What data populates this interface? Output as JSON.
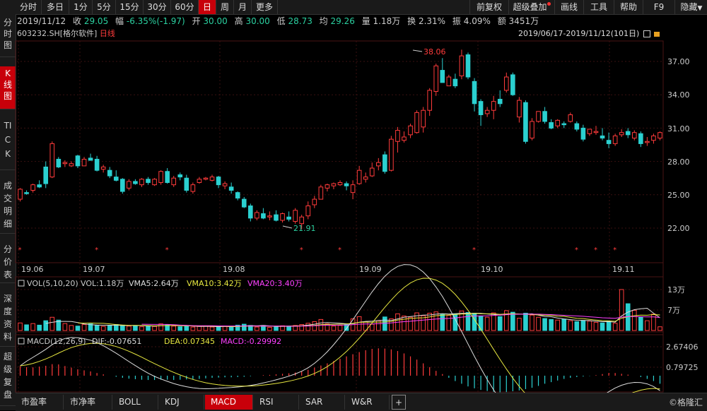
{
  "topbar": {
    "tabs": [
      "分时",
      "多日",
      "1分",
      "5分",
      "15分",
      "30分",
      "60分",
      "日",
      "周",
      "月",
      "更多"
    ],
    "active_tab": "日",
    "right": [
      "前复权",
      "超级叠加",
      "画线",
      "工具",
      "帮助",
      "F9",
      "隐藏"
    ]
  },
  "quote": {
    "date": "2019/11/12",
    "close_label": "收",
    "close": "29.05",
    "change_label": "幅",
    "change": "-6.35%(-1.97)",
    "open_label": "开",
    "open": "30.00",
    "high_label": "高",
    "high": "30.00",
    "low_label": "低",
    "low": "28.73",
    "avg_label": "均",
    "avg": "29.26",
    "volume_label": "量",
    "volume": "1.18万",
    "turnover_label": "换",
    "turnover": "2.31%",
    "amplitude_label": "振",
    "amplitude": "4.09%",
    "amount_label": "额",
    "amount": "3451万"
  },
  "leftnav": [
    "分时图",
    "K线图",
    "TICK",
    "成交明细",
    "分价表",
    "深度资料",
    "超级复盘"
  ],
  "leftnav_active": "K线图",
  "chart_header": {
    "symbol": "603232.SH",
    "name": "[格尔软件]",
    "period": "日线",
    "date_range": "2019/06/17-2019/11/12(101日)"
  },
  "price_axis": [
    "37.00",
    "34.00",
    "31.00",
    "28.00",
    "25.00",
    "22.00"
  ],
  "date_axis": [
    "19.06",
    "19.07",
    "19.08",
    "19.09",
    "19.10",
    "19.11"
  ],
  "annotations": {
    "high": "38.06",
    "low": "21.91"
  },
  "vol_header": {
    "title": "VOL(5,10,20)",
    "vol": "VOL:1.18万",
    "vma5": "VMA5:2.64万",
    "vma10": "VMA10:3.42万",
    "vma20": "VMA20:3.40万"
  },
  "vol_axis": [
    "13万",
    "7万"
  ],
  "macd_header": {
    "title": "MACD(12,26,9)",
    "dif": "DIF:-0.07651",
    "dea": "DEA:0.07345",
    "macd": "MACD:-0.29992"
  },
  "macd_axis": [
    "2.67406",
    "0.79725"
  ],
  "bottombar": [
    "市盈率",
    "市净率",
    "BOLL",
    "KDJ",
    "MACD",
    "RSI",
    "SAR",
    "W&R",
    "+"
  ],
  "bottom_active": "MACD",
  "watermark": "©格隆汇",
  "colors": {
    "up": "#ff3b3b",
    "down": "#2bd0d0",
    "accent": "#c8000a",
    "grid": "#3a1010"
  },
  "chart_data": {
    "type": "candlestick",
    "ylim": [
      21,
      38.5
    ],
    "candles": [
      [
        24.6,
        25.6,
        24.4,
        25.5
      ],
      [
        25.2,
        25.4,
        25.0,
        25.1
      ],
      [
        25.4,
        26.0,
        25.2,
        25.9
      ],
      [
        25.9,
        26.3,
        25.6,
        25.7
      ],
      [
        27.5,
        28.0,
        25.6,
        26.0
      ],
      [
        26.6,
        29.8,
        26.5,
        29.6
      ],
      [
        28.2,
        28.4,
        27.4,
        27.5
      ],
      [
        27.8,
        28.1,
        27.5,
        27.9
      ],
      [
        27.6,
        28.0,
        27.5,
        27.8
      ],
      [
        28.5,
        28.6,
        27.4,
        27.6
      ],
      [
        27.6,
        28.4,
        27.6,
        28.2
      ],
      [
        28.3,
        28.7,
        28.1,
        28.1
      ],
      [
        28.2,
        28.5,
        27.1,
        27.2
      ],
      [
        27.3,
        27.7,
        27.0,
        27.5
      ],
      [
        27.2,
        27.5,
        26.5,
        26.7
      ],
      [
        26.6,
        27.2,
        26.2,
        26.3
      ],
      [
        26.4,
        26.5,
        25.1,
        25.3
      ],
      [
        25.6,
        26.4,
        25.4,
        26.2
      ],
      [
        26.2,
        26.4,
        25.9,
        26.0
      ],
      [
        25.9,
        26.5,
        25.7,
        26.4
      ],
      [
        26.4,
        26.6,
        25.9,
        26.1
      ],
      [
        25.9,
        26.5,
        25.8,
        26.4
      ],
      [
        26.1,
        27.2,
        25.9,
        27.1
      ],
      [
        27.1,
        27.4,
        26.0,
        26.1
      ],
      [
        25.9,
        26.7,
        25.7,
        26.5
      ],
      [
        26.8,
        27.0,
        26.3,
        26.6
      ],
      [
        26.5,
        26.8,
        25.2,
        25.4
      ],
      [
        25.3,
        26.1,
        25.1,
        25.9
      ],
      [
        26.1,
        26.6,
        26.0,
        26.4
      ],
      [
        26.4,
        26.6,
        26.3,
        26.5
      ],
      [
        26.3,
        26.8,
        26.2,
        26.6
      ],
      [
        26.6,
        26.7,
        25.6,
        25.9
      ],
      [
        25.8,
        26.2,
        25.5,
        26.0
      ],
      [
        25.7,
        26.1,
        25.1,
        25.4
      ],
      [
        25.2,
        25.3,
        24.5,
        24.7
      ],
      [
        24.6,
        24.8,
        23.8,
        23.9
      ],
      [
        24.0,
        24.2,
        22.6,
        22.9
      ],
      [
        22.9,
        23.6,
        22.7,
        23.4
      ],
      [
        23.3,
        23.8,
        22.8,
        22.9
      ],
      [
        23.0,
        23.5,
        22.7,
        23.1
      ],
      [
        23.2,
        23.6,
        22.6,
        22.7
      ],
      [
        22.7,
        23.4,
        22.5,
        23.3
      ],
      [
        23.0,
        23.5,
        22.6,
        22.8
      ],
      [
        22.6,
        23.8,
        22.4,
        23.6
      ],
      [
        22.4,
        23.2,
        21.9,
        23.0
      ],
      [
        23.1,
        24.4,
        22.8,
        24.0
      ],
      [
        24.1,
        24.9,
        23.8,
        24.6
      ],
      [
        24.6,
        25.9,
        24.6,
        25.7
      ],
      [
        25.6,
        26.0,
        25.3,
        25.9
      ],
      [
        25.8,
        26.1,
        25.5,
        26.0
      ],
      [
        25.9,
        26.3,
        25.8,
        26.1
      ],
      [
        26.0,
        26.2,
        25.4,
        25.8
      ],
      [
        25.2,
        26.3,
        24.6,
        25.9
      ],
      [
        26.0,
        27.6,
        25.9,
        27.2
      ],
      [
        26.4,
        27.0,
        26.1,
        26.6
      ],
      [
        26.7,
        27.9,
        26.6,
        27.4
      ],
      [
        27.6,
        28.3,
        27.2,
        27.9
      ],
      [
        28.6,
        28.9,
        26.9,
        27.1
      ],
      [
        27.2,
        30.3,
        27.1,
        30.0
      ],
      [
        29.8,
        31.1,
        28.8,
        30.8
      ],
      [
        29.9,
        30.7,
        29.7,
        30.2
      ],
      [
        30.4,
        31.4,
        30.1,
        31.2
      ],
      [
        30.6,
        32.6,
        30.5,
        32.4
      ],
      [
        31.1,
        32.9,
        30.6,
        32.6
      ],
      [
        32.6,
        34.6,
        32.1,
        34.4
      ],
      [
        34.3,
        36.8,
        33.9,
        36.6
      ],
      [
        36.2,
        37.3,
        35.1,
        35.1
      ],
      [
        34.8,
        35.8,
        34.8,
        35.6
      ],
      [
        35.4,
        35.9,
        34.6,
        34.8
      ],
      [
        35.7,
        38.06,
        35.4,
        37.5
      ],
      [
        37.6,
        37.8,
        35.4,
        35.6
      ],
      [
        35.2,
        35.5,
        32.5,
        33.2
      ],
      [
        33.4,
        33.6,
        31.2,
        32.2
      ],
      [
        32.3,
        32.9,
        32.0,
        32.6
      ],
      [
        32.6,
        33.9,
        31.8,
        33.4
      ],
      [
        33.6,
        34.4,
        32.9,
        33.2
      ],
      [
        34.4,
        36.0,
        34.2,
        35.6
      ],
      [
        35.8,
        36.0,
        33.9,
        34.0
      ],
      [
        32.0,
        33.8,
        31.5,
        33.5
      ],
      [
        33.3,
        33.5,
        29.6,
        29.8
      ],
      [
        30.1,
        31.9,
        29.9,
        31.6
      ],
      [
        31.6,
        32.5,
        31.5,
        32.5
      ],
      [
        32.5,
        32.9,
        31.4,
        31.6
      ],
      [
        31.5,
        31.8,
        30.9,
        31.0
      ],
      [
        31.2,
        31.8,
        31.0,
        31.7
      ],
      [
        31.4,
        31.6,
        31.0,
        31.3
      ],
      [
        31.6,
        32.4,
        31.5,
        32.2
      ],
      [
        31.4,
        31.6,
        30.7,
        30.9
      ],
      [
        31.0,
        31.3,
        29.8,
        30.0
      ],
      [
        30.5,
        30.9,
        30.3,
        30.9
      ],
      [
        30.6,
        31.2,
        30.4,
        30.7
      ],
      [
        30.3,
        31.0,
        29.9,
        30.1
      ],
      [
        29.9,
        30.6,
        29.2,
        29.6
      ],
      [
        29.6,
        30.5,
        29.4,
        30.3
      ],
      [
        30.4,
        30.9,
        30.2,
        30.6
      ],
      [
        30.7,
        31.0,
        30.1,
        30.4
      ],
      [
        30.1,
        30.8,
        29.9,
        30.6
      ],
      [
        30.5,
        30.7,
        29.3,
        29.6
      ],
      [
        29.7,
        30.2,
        29.4,
        29.8
      ],
      [
        29.9,
        30.5,
        29.6,
        30.3
      ],
      [
        30.1,
        30.7,
        29.9,
        30.6
      ]
    ],
    "volumes_wan": [
      2.4,
      1.8,
      2.2,
      1.7,
      3.1,
      4.2,
      3.3,
      2.2,
      1.6,
      1.4,
      1.9,
      2.1,
      1.6,
      1.3,
      1.5,
      1.9,
      1.7,
      1.4,
      1.5,
      1.2,
      1.5,
      1.3,
      2.1,
      1.8,
      1.4,
      1.2,
      1.5,
      1.1,
      1.3,
      1.4,
      1.1,
      1.2,
      1.4,
      1.0,
      1.7,
      2.0,
      1.6,
      1.1,
      1.6,
      1.0,
      1.2,
      1.5,
      1.4,
      1.6,
      1.9,
      2.3,
      2.8,
      3.5,
      2.1,
      1.4,
      1.6,
      2.0,
      3.7,
      4.4,
      2.8,
      2.0,
      3.1,
      4.3,
      3.7,
      5.3,
      4.6,
      4.2,
      5.6,
      4.7,
      5.5,
      5.9,
      5.1,
      4.8,
      5.3,
      6.2,
      5.7,
      5.5,
      4.6,
      4.2,
      5.6,
      4.4,
      6.3,
      5.8,
      3.9,
      5.5,
      4.9,
      4.2,
      3.8,
      3.5,
      3.3,
      3.6,
      3.1,
      2.8,
      3.2,
      3.0,
      2.6,
      2.4,
      2.9,
      2.3,
      13.0,
      8.5,
      6.4,
      4.3,
      3.1,
      5.2,
      1.18
    ],
    "macd_bars": [
      0.35,
      0.32,
      0.31,
      0.34,
      0.37,
      0.43,
      0.42,
      0.36,
      0.3,
      0.24,
      0.2,
      0.16,
      0.1,
      0.05,
      0.0,
      -0.04,
      -0.08,
      -0.11,
      -0.13,
      -0.15,
      -0.16,
      -0.16,
      -0.15,
      -0.15,
      -0.16,
      -0.15,
      -0.14,
      -0.13,
      -0.12,
      -0.1,
      -0.08,
      -0.07,
      -0.06,
      -0.06,
      -0.05,
      -0.04,
      -0.02,
      0.0,
      0.02,
      0.03,
      0.05,
      0.07,
      0.09,
      0.12,
      0.16,
      0.22,
      0.3,
      0.38,
      0.46,
      0.55,
      0.63,
      0.72,
      0.8,
      0.88,
      0.95,
      1.0,
      1.02,
      1.01,
      0.98,
      0.92,
      0.83,
      0.72,
      0.6,
      0.46,
      0.32,
      0.18,
      0.06,
      -0.08,
      -0.2,
      -0.3,
      -0.4,
      -0.47,
      -0.53,
      -0.57,
      -0.6,
      -0.62,
      -0.61,
      -0.58,
      -0.55,
      -0.5,
      -0.45,
      -0.38,
      -0.3,
      -0.24,
      -0.18,
      -0.12,
      -0.08,
      -0.05,
      -0.03,
      -0.01,
      0.02,
      0.06,
      0.1,
      0.1,
      0.07,
      0.04,
      0.0,
      -0.05,
      -0.12,
      -0.2,
      -0.3
    ],
    "dif_range": [
      -0.9,
      2.9
    ]
  }
}
